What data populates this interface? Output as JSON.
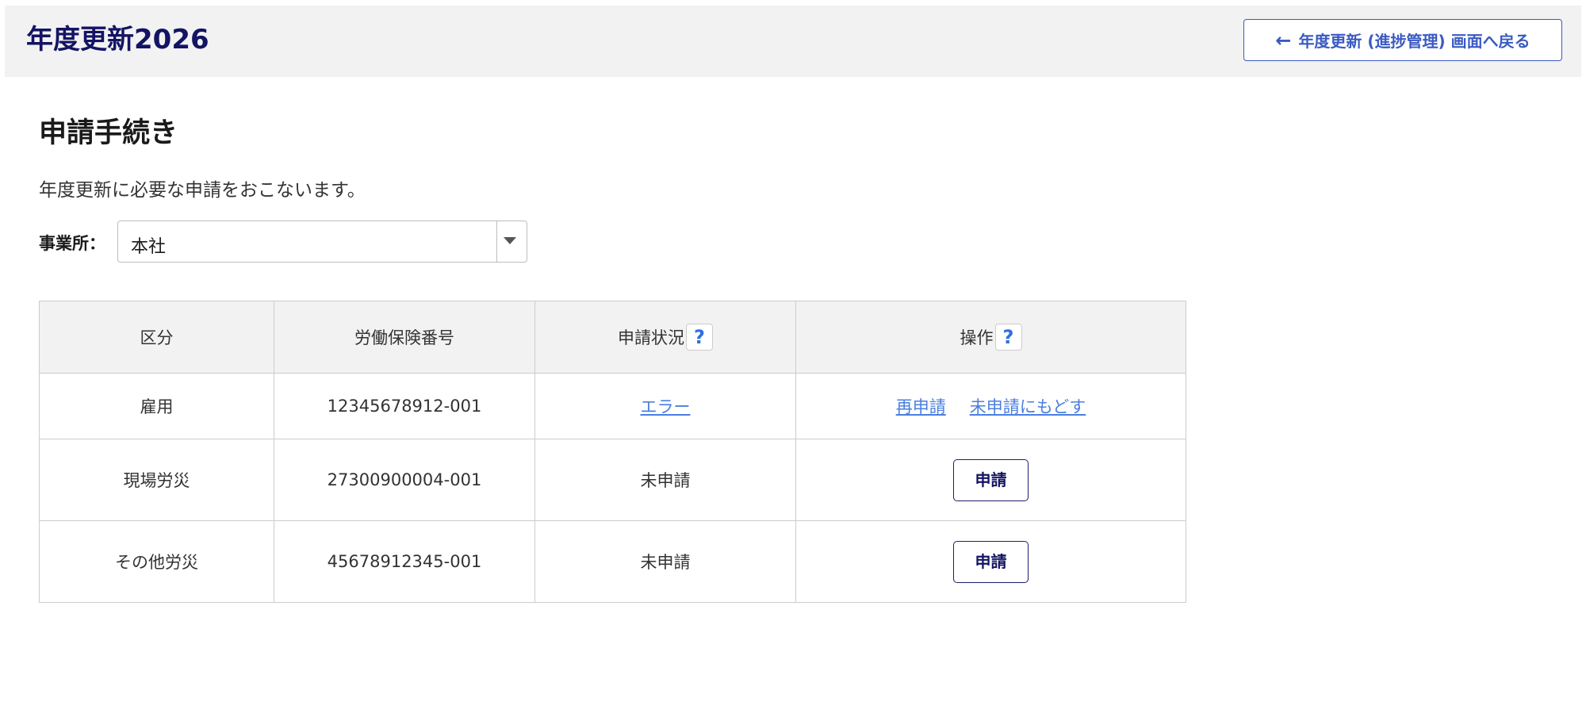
{
  "header": {
    "title": "年度更新2026",
    "back_button_label": "年度更新 (進捗管理) 画面へ戻る",
    "back_icon": "←"
  },
  "page": {
    "title": "申請手続き",
    "description": "年度更新に必要な申請をおこないます。"
  },
  "office": {
    "label": "事業所：",
    "selected": "本社"
  },
  "table": {
    "headers": [
      "区分",
      "労働保険番号",
      "申請状況",
      "操作"
    ],
    "help_icon": "?",
    "rows": [
      {
        "category": "雇用",
        "number": "12345678912-001",
        "status": "エラー",
        "actions": [
          "再申請",
          "未申請にもどす"
        ]
      },
      {
        "category": "現場労災",
        "number": "27300900004-001",
        "status": "未申請",
        "action_button": "申請"
      },
      {
        "category": "その他労災",
        "number": "45678912345-001",
        "status": "未申請",
        "action_button": "申請"
      }
    ]
  },
  "colors": {
    "title_navy": "#141464",
    "accent_blue": "#3a5ac2",
    "link_blue": "#4a7fe0",
    "header_bg": "#f2f2f2",
    "border": "#cccccc"
  }
}
